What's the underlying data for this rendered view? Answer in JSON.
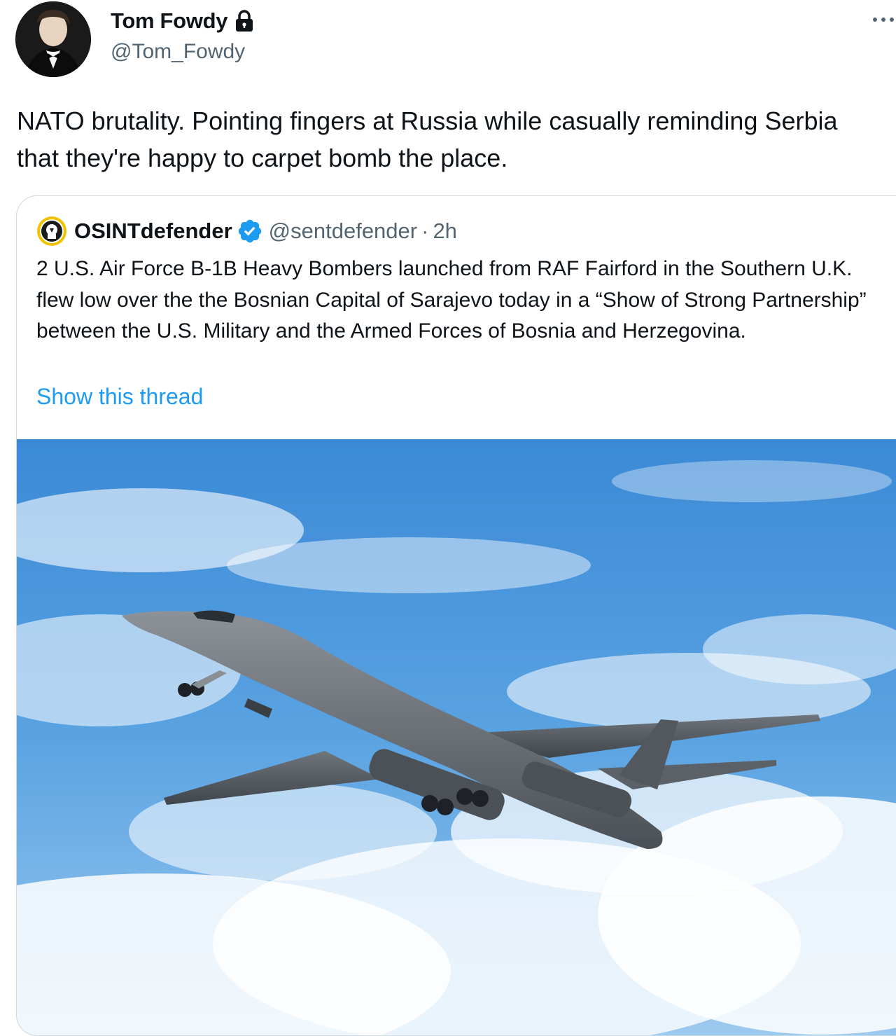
{
  "author": {
    "name": "Tom Fowdy",
    "handle": "@Tom_Fowdy",
    "avatar_icon": "profile-photo",
    "protected_icon": "lock-icon"
  },
  "tweet": {
    "text": "NATO brutality. Pointing fingers at Russia while casually reminding Serbia that they're happy to carpet bomb the place.",
    "more_icon": "more-horizontal-icon"
  },
  "quoted_tweet": {
    "author_name": "OSINTdefender",
    "verified_icon": "verified-badge-icon",
    "handle": "@sentdefender",
    "separator": "·",
    "time": "2h",
    "text": "2 U.S. Air Force B-1B Heavy Bombers launched from RAF Fairford in the Southern U.K. flew low over the the Bosnian Capital of Sarajevo today in a “Show of Strong Partnership” between the U.S. Military and the Armed Forces of Bosnia and Herzegovina.",
    "thread_link": "Show this thread",
    "media": "photo of B-1B bomber in flight against blue sky"
  },
  "colors": {
    "text_primary": "#0f1419",
    "text_secondary": "#536471",
    "link": "#1d9bf0",
    "verified": "#1d9bf0",
    "border": "#cfd9de"
  }
}
